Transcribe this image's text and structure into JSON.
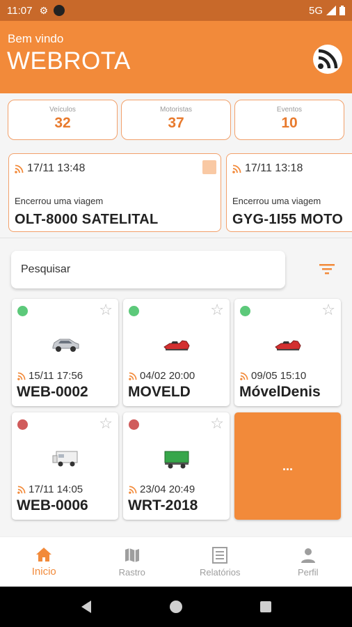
{
  "status_bar": {
    "time": "11:07",
    "network": "5G"
  },
  "header": {
    "welcome": "Bem vindo",
    "brand": "WEBROTA"
  },
  "stats": [
    {
      "label": "Veículos",
      "value": "32"
    },
    {
      "label": "Motoristas",
      "value": "37"
    },
    {
      "label": "Eventos",
      "value": "10"
    }
  ],
  "events": [
    {
      "time": "17/11 13:48",
      "description": "Encerrou uma viagem",
      "plate": "OLT-8000 SATELITAL"
    },
    {
      "time": "17/11 13:18",
      "description": "Encerrou uma viagem",
      "plate": "GYG-1I55 MOTO"
    }
  ],
  "search": {
    "placeholder": "Pesquisar"
  },
  "vehicles": [
    {
      "timestamp": "15/11 17:56",
      "plate": "WEB-0002",
      "status": "online",
      "icon": "car-icon"
    },
    {
      "timestamp": "04/02 20:00",
      "plate": "MOVELD",
      "status": "online",
      "icon": "jetski-icon"
    },
    {
      "timestamp": "09/05 15:10",
      "plate": "MóvelDenis",
      "status": "online",
      "icon": "jetski-icon"
    },
    {
      "timestamp": "17/11 14:05",
      "plate": "WEB-0006",
      "status": "offline",
      "icon": "trailer-icon"
    },
    {
      "timestamp": "23/04 20:49",
      "plate": "WRT-2018",
      "status": "offline",
      "icon": "truck-icon"
    }
  ],
  "more_tile": {
    "label": "..."
  },
  "bottom_nav": [
    {
      "label": "Inicio",
      "icon": "home-icon",
      "active": true
    },
    {
      "label": "Rastro",
      "icon": "map-icon",
      "active": false
    },
    {
      "label": "Relatórios",
      "icon": "report-icon",
      "active": false
    },
    {
      "label": "Perfil",
      "icon": "person-icon",
      "active": false
    }
  ],
  "colors": {
    "primary": "#f28a3a",
    "status_bar": "#c8692a",
    "online": "#5cc97a",
    "offline": "#d05b5b",
    "accent_light": "#f9c9a4"
  }
}
